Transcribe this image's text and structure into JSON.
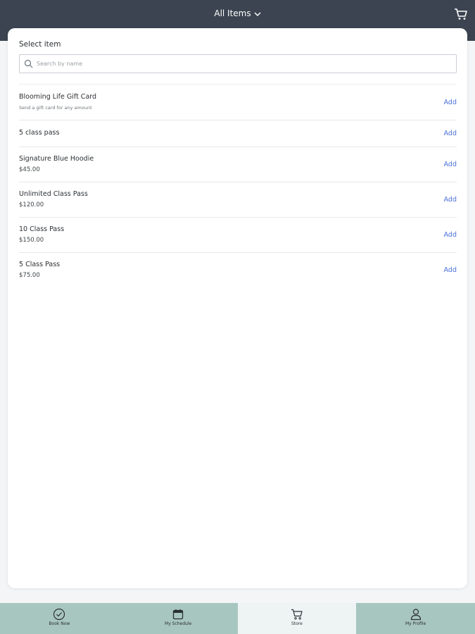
{
  "header": {
    "title": "All Items",
    "chevron_icon": "chevron-down-icon",
    "cart_icon": "cart-icon"
  },
  "select": {
    "label": "Select item",
    "search_placeholder": "Search by name",
    "search_value": ""
  },
  "items": [
    {
      "name": "Blooming Life Gift Card",
      "sub": "Send a gift card for any amount",
      "add": "Add"
    },
    {
      "name": "5 class pass",
      "sub": "",
      "add": "Add"
    },
    {
      "name": "Signature Blue Hoodie",
      "sub": "$45.00",
      "add": "Add"
    },
    {
      "name": "Unlimited Class Pass",
      "sub": "$120.00",
      "add": "Add"
    },
    {
      "name": "10 Class Pass",
      "sub": "$150.00",
      "add": "Add"
    },
    {
      "name": "5 Class Pass",
      "sub": "$75.00",
      "add": "Add"
    }
  ],
  "nav": [
    {
      "label": "Book Now",
      "icon": "check-circle-icon",
      "active": false
    },
    {
      "label": "My Schedule",
      "icon": "calendar-icon",
      "active": false
    },
    {
      "label": "Store",
      "icon": "cart-icon",
      "active": true
    },
    {
      "label": "My Profile",
      "icon": "user-icon",
      "active": false
    }
  ],
  "colors": {
    "header_bg": "#3b4450",
    "accent_link": "#4a72d8",
    "nav_bg": "#a8c6c0",
    "nav_active_bg": "#eef4f3"
  }
}
